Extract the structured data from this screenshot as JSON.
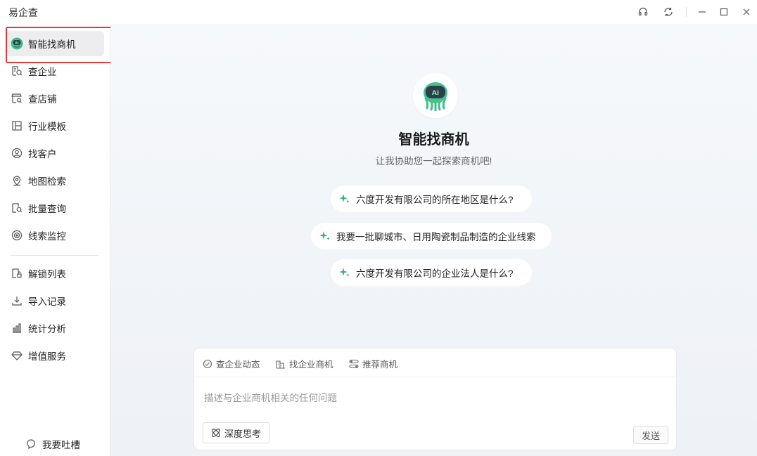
{
  "app": {
    "title": "易企查"
  },
  "window_controls": [
    "headset-icon",
    "refresh-icon",
    "minimize-icon",
    "maximize-icon",
    "close-icon"
  ],
  "sidebar": {
    "items": [
      {
        "label": "智能找商机",
        "icon": "ai-robot-icon",
        "active": true
      },
      {
        "label": "查企业",
        "icon": "company-search-icon"
      },
      {
        "label": "查店铺",
        "icon": "store-search-icon"
      },
      {
        "label": "行业模板",
        "icon": "template-icon"
      },
      {
        "label": "找客户",
        "icon": "customer-icon"
      },
      {
        "label": "地图检索",
        "icon": "map-pin-icon"
      },
      {
        "label": "批量查询",
        "icon": "batch-search-icon"
      },
      {
        "label": "线索监控",
        "icon": "monitor-icon"
      },
      {
        "label": "解锁列表",
        "icon": "unlock-list-icon"
      },
      {
        "label": "导入记录",
        "icon": "import-icon"
      },
      {
        "label": "统计分析",
        "icon": "bar-chart-icon"
      },
      {
        "label": "增值服务",
        "icon": "diamond-icon"
      }
    ],
    "feedback_label": "我要吐槽"
  },
  "main": {
    "title": "智能找商机",
    "subtitle": "让我协助您一起探索商机吧!",
    "suggestions": [
      "六度开发有限公司的所在地区是什么?",
      "我要一批聊城市、日用陶瓷制品制造的企业线索",
      "六度开发有限公司的企业法人是什么?"
    ]
  },
  "composer": {
    "tabs": [
      {
        "label": "查企业动态",
        "icon": "dynamic-icon"
      },
      {
        "label": "找企业商机",
        "icon": "building-icon"
      },
      {
        "label": "推荐商机",
        "icon": "recommend-icon"
      }
    ],
    "placeholder": "描述与企业商机相关的任何问题",
    "value": "",
    "deep_think_label": "深度思考",
    "send_label": "发送"
  },
  "colors": {
    "accent_green": "#2fb57a",
    "robot_face": "#2f3e4a",
    "highlight_red": "#e53935"
  }
}
